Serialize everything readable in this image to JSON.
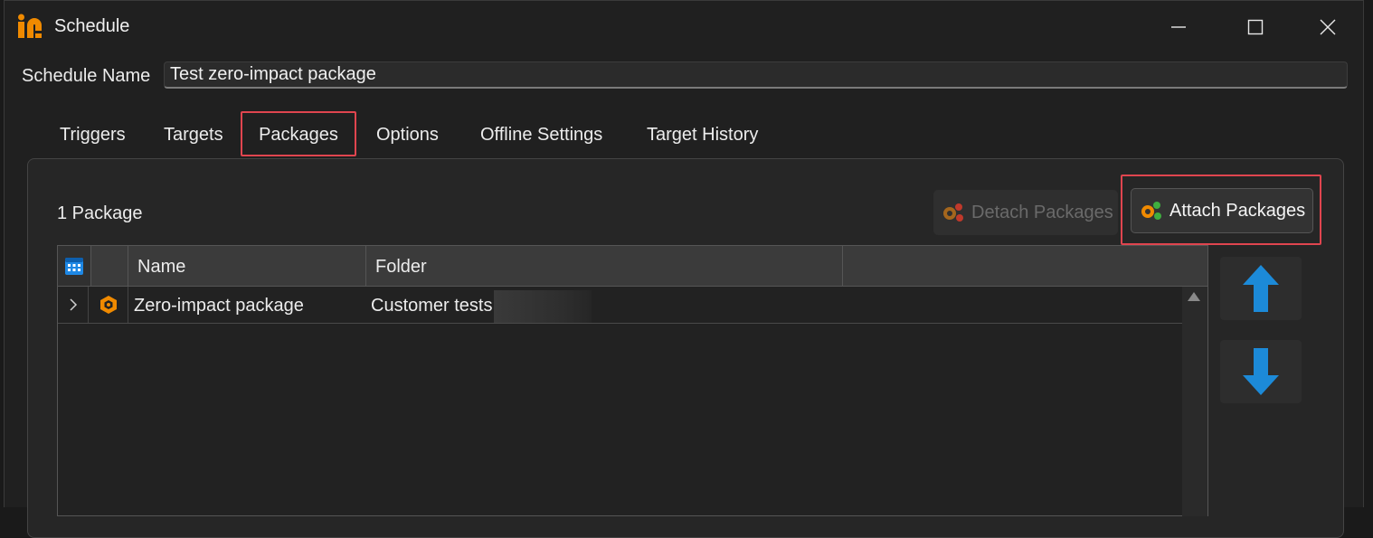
{
  "window": {
    "title": "Schedule"
  },
  "schedule": {
    "label": "Schedule Name",
    "value": "Test zero-impact package"
  },
  "tabs": [
    {
      "label": "Triggers",
      "selected": false
    },
    {
      "label": "Targets",
      "selected": false
    },
    {
      "label": "Packages",
      "selected": true
    },
    {
      "label": "Options",
      "selected": false
    },
    {
      "label": "Offline Settings",
      "selected": false
    },
    {
      "label": "Target History",
      "selected": false
    }
  ],
  "packages": {
    "count_text": "1 Package",
    "detach_label": "Detach Packages",
    "attach_label": "Attach Packages",
    "columns": [
      "Name",
      "Folder"
    ],
    "rows": [
      {
        "name": "Zero-impact package",
        "folder": "Customer tests"
      }
    ]
  },
  "colors": {
    "highlight": "#e0454f",
    "brand_orange": "#f08a00",
    "arrow_blue": "#1c8ad8"
  },
  "icons": [
    "app-logo-icon",
    "minimize-icon",
    "maximize-icon",
    "close-icon",
    "detach-packages-icon",
    "attach-packages-icon",
    "calendar-icon",
    "chevron-right-icon",
    "package-icon",
    "arrow-up-icon",
    "arrow-down-icon"
  ]
}
